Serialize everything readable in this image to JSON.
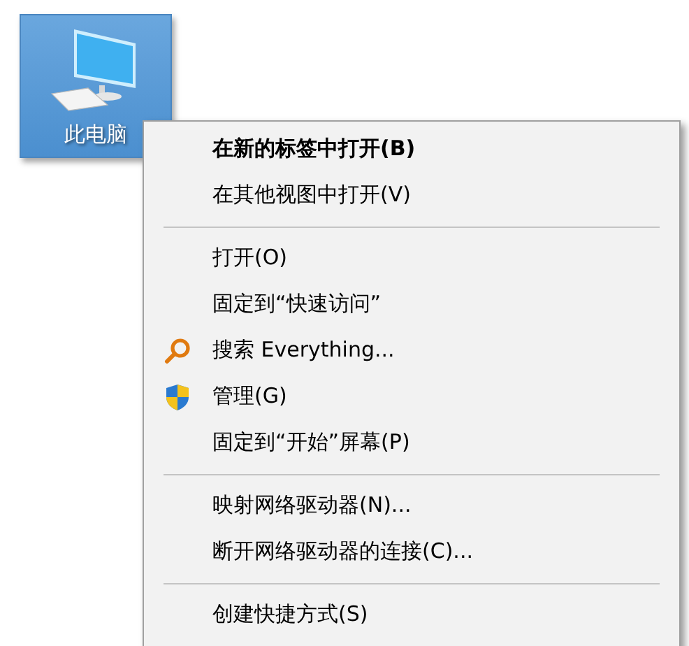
{
  "desktop_icon": {
    "label": "此电脑",
    "selected": true
  },
  "context_menu": {
    "items": [
      {
        "kind": "item",
        "label": "在新的标签中打开(B)",
        "default": true
      },
      {
        "kind": "item",
        "label": "在其他视图中打开(V)",
        "default": false
      },
      {
        "kind": "separator"
      },
      {
        "kind": "item",
        "label": "打开(O)",
        "default": false
      },
      {
        "kind": "item",
        "label": "固定到“快速访问”",
        "default": false
      },
      {
        "kind": "search",
        "label": "搜索 Everything...",
        "default": false
      },
      {
        "kind": "admin",
        "label": "管理(G)",
        "default": false
      },
      {
        "kind": "item",
        "label": "固定到“开始”屏幕(P)",
        "default": false
      },
      {
        "kind": "separator"
      },
      {
        "kind": "item",
        "label": "映射网络驱动器(N)...",
        "default": false
      },
      {
        "kind": "item",
        "label": "断开网络驱动器的连接(C)...",
        "default": false
      },
      {
        "kind": "separator"
      },
      {
        "kind": "item",
        "label": "创建快捷方式(S)",
        "default": false
      }
    ]
  }
}
